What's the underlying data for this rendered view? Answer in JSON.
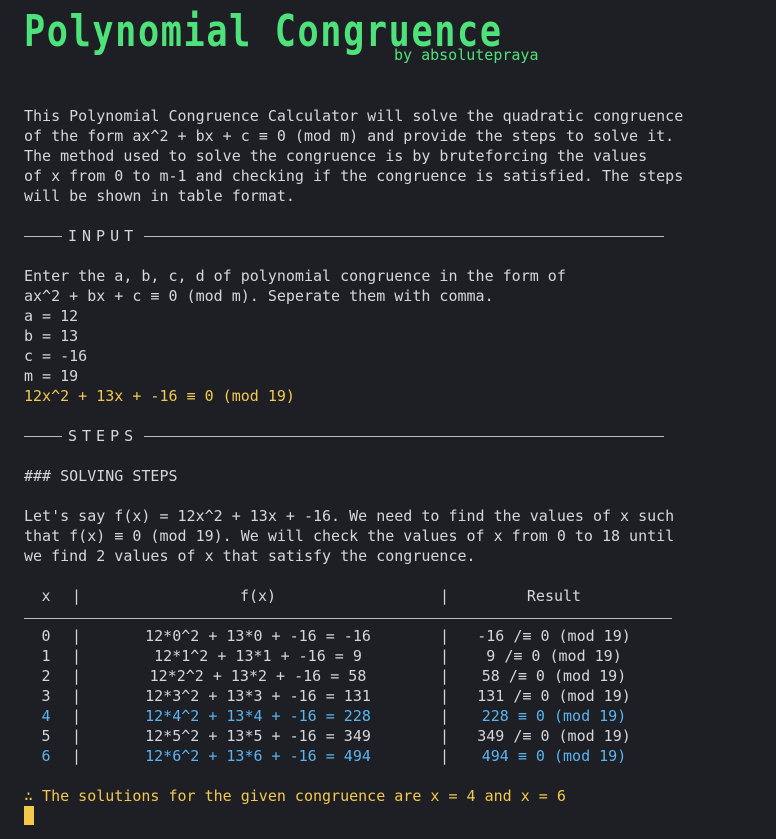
{
  "banner": {
    "title": "Polynomial Congruence",
    "byline": "by absolutepraya"
  },
  "intro": [
    "This Polynomial Congruence Calculator will solve the quadratic congruence",
    "of the form ax^2 + bx + c ≡ 0 (mod m) and provide the steps to solve it.",
    "The method used to solve the congruence is by bruteforcing the values",
    "of x from 0 to m-1 and checking if the congruence is satisfied. The steps",
    "will be shown in table format."
  ],
  "sections": {
    "input": "INPUT",
    "steps": "STEPS"
  },
  "input": {
    "prompt": [
      "Enter the a, b, c, d of polynomial congruence in the form of",
      "ax^2 + bx + c ≡ 0 (mod m). Seperate them with comma."
    ],
    "values": [
      "a = 12",
      "b = 13",
      "c = -16",
      "m = 19"
    ],
    "equation": "12x^2 + 13x + -16 ≡ 0 (mod 19)"
  },
  "steps": {
    "heading": "### SOLVING STEPS",
    "explanation": [
      "Let's say f(x) = 12x^2 + 13x + -16. We need to find the values of x such",
      "that f(x) ≡ 0 (mod 19). We will check the values of x from 0 to 18 until",
      "we find 2 values of x that satisfy the congruence."
    ]
  },
  "table": {
    "headers": {
      "x": "x",
      "fx": "f(x)",
      "result": "Result"
    },
    "separator": "|",
    "rows": [
      {
        "x": "0",
        "fx": "12*0^2 + 13*0 + -16 = -16",
        "result": "-16 /≡ 0 (mod 19)",
        "solution": false
      },
      {
        "x": "1",
        "fx": "12*1^2 + 13*1 + -16 = 9",
        "result": "9 /≡ 0 (mod 19)",
        "solution": false
      },
      {
        "x": "2",
        "fx": "12*2^2 + 13*2 + -16 = 58",
        "result": "58 /≡ 0 (mod 19)",
        "solution": false
      },
      {
        "x": "3",
        "fx": "12*3^2 + 13*3 + -16 = 131",
        "result": "131 /≡ 0 (mod 19)",
        "solution": false
      },
      {
        "x": "4",
        "fx": "12*4^2 + 13*4 + -16 = 228",
        "result": "228 ≡ 0 (mod 19)",
        "solution": true
      },
      {
        "x": "5",
        "fx": "12*5^2 + 13*5 + -16 = 349",
        "result": "349 /≡ 0 (mod 19)",
        "solution": false
      },
      {
        "x": "6",
        "fx": "12*6^2 + 13*6 + -16 = 494",
        "result": "494 ≡ 0 (mod 19)",
        "solution": true
      }
    ]
  },
  "conclusion": "∴ The solutions for the given congruence are x = 4 and x = 6",
  "colors": {
    "banner": "#4ee27a",
    "highlight": "#f2c94c",
    "solution": "#5ab4f0",
    "text": "#d4d6da",
    "background": "#1e1f25"
  }
}
